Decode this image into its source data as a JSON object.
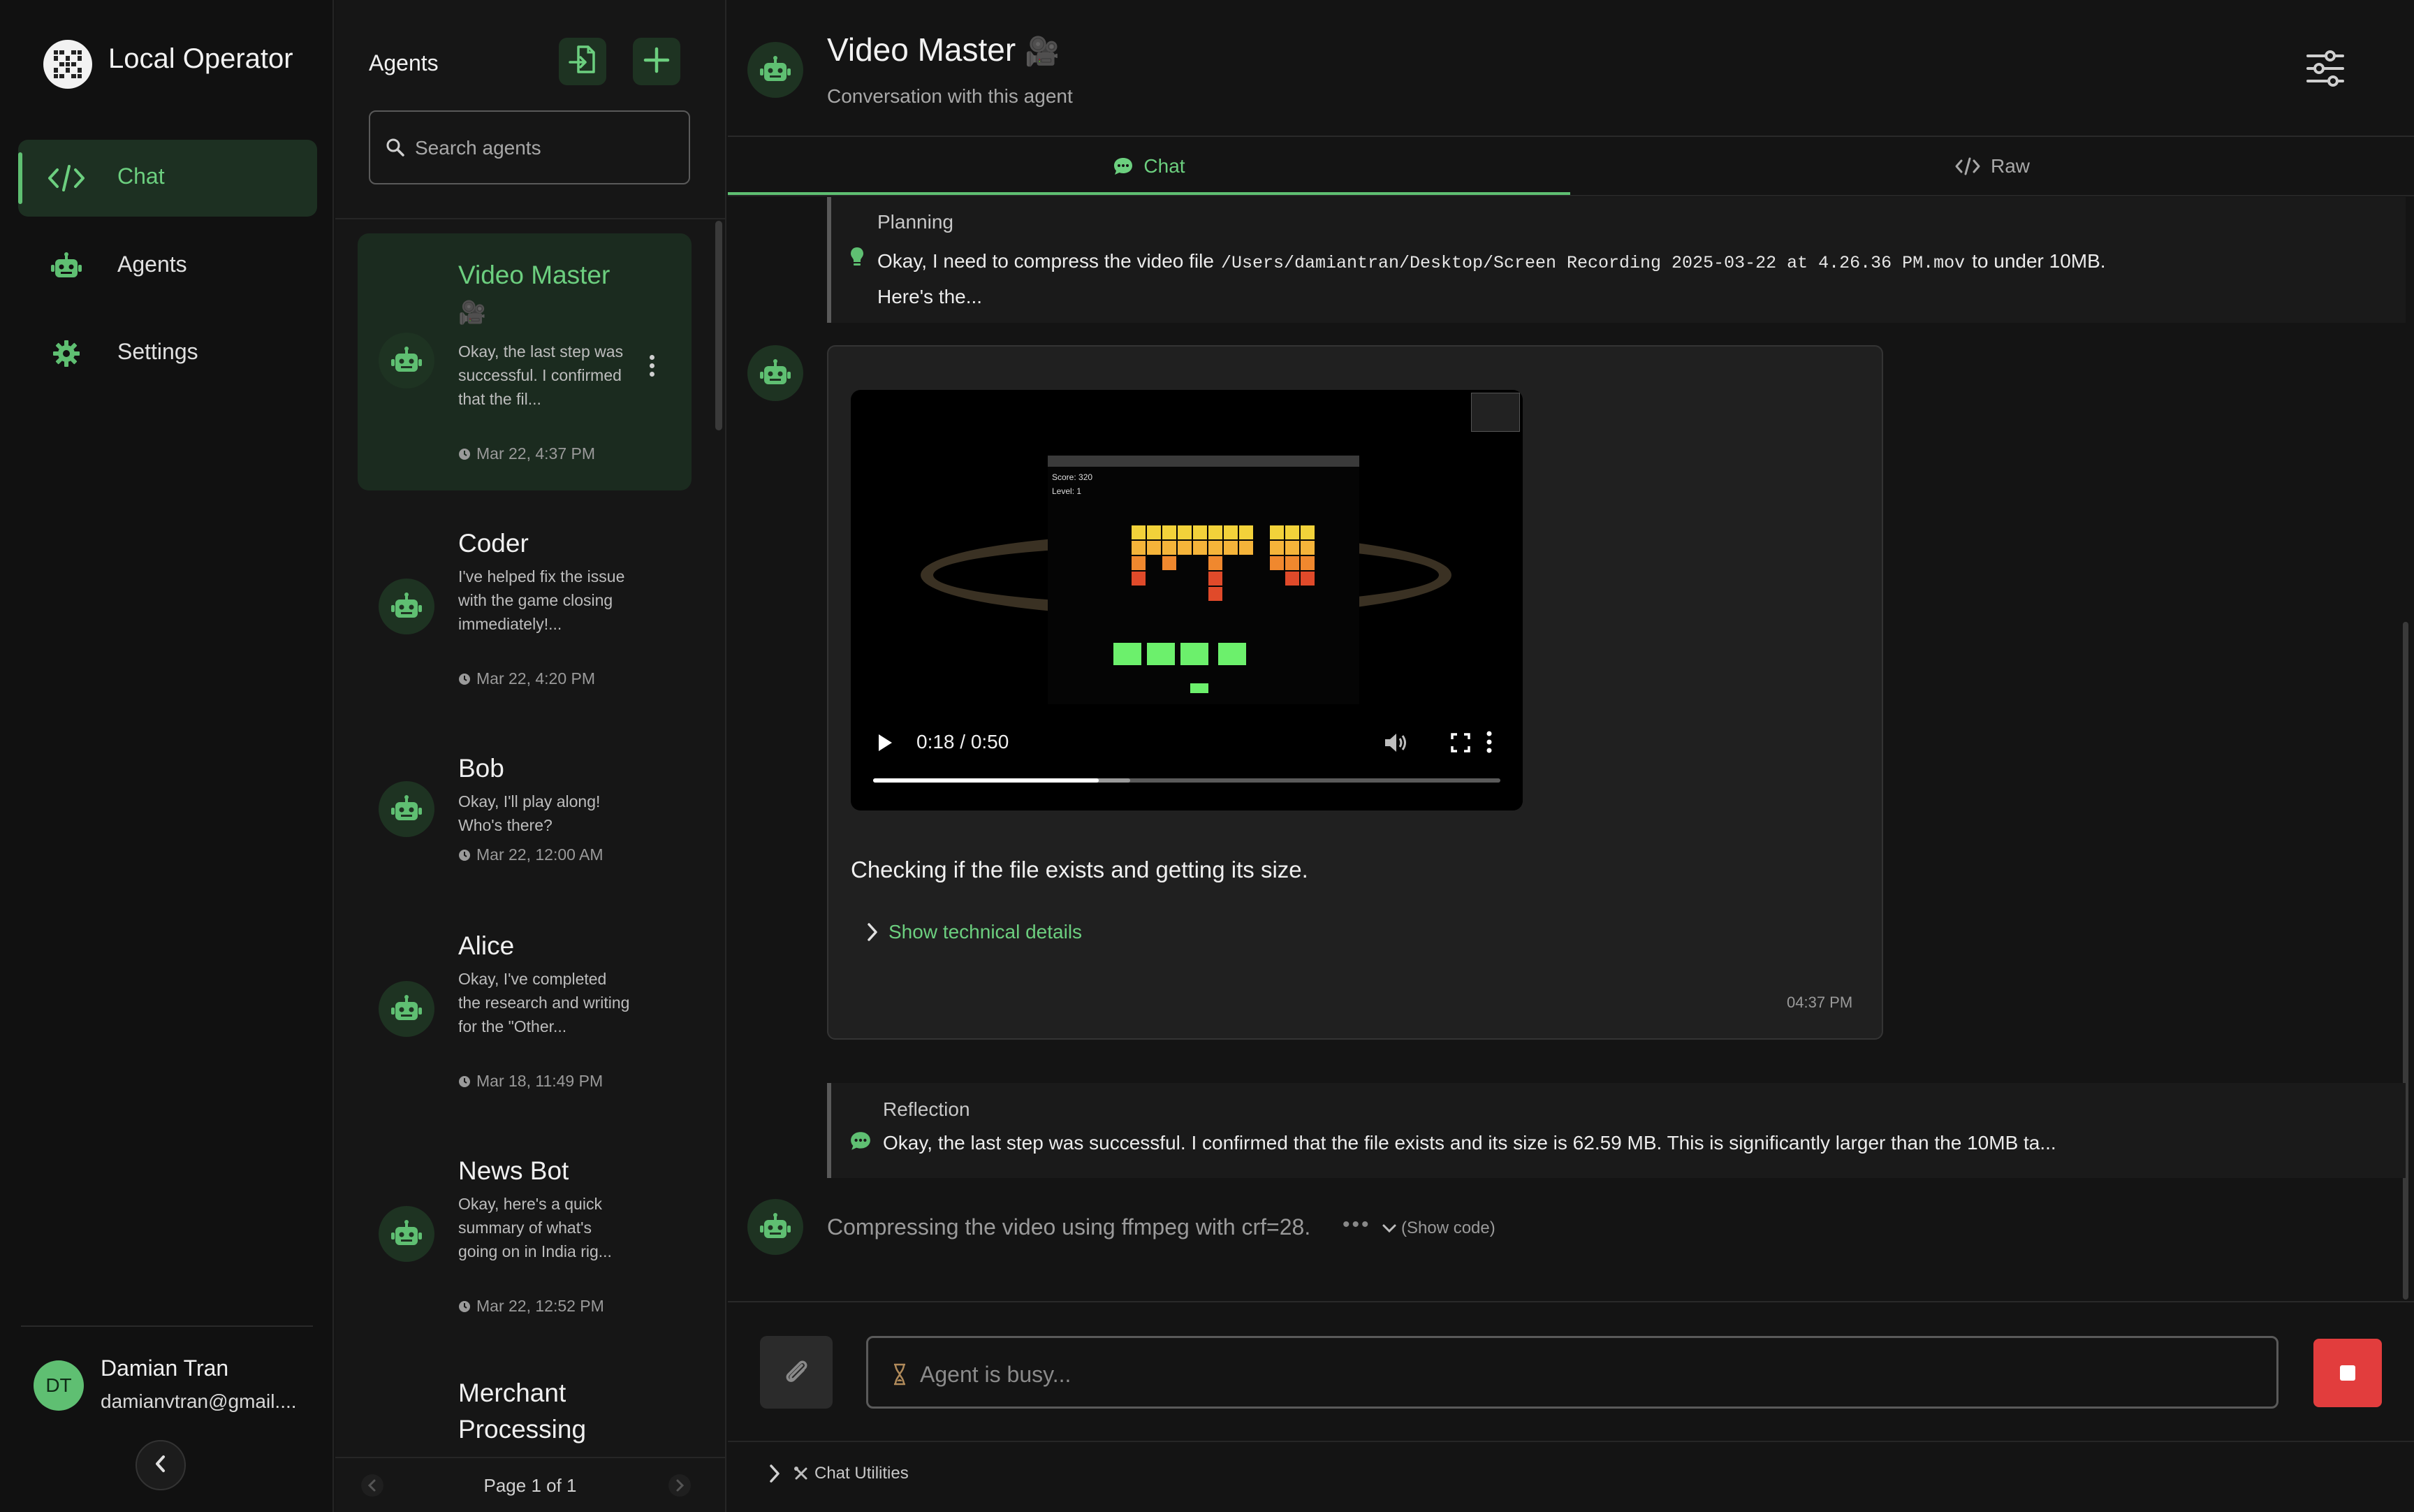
{
  "app": {
    "title": "Local Operator"
  },
  "nav": {
    "items": [
      {
        "label": "Chat",
        "icon": "code-icon",
        "active": true
      },
      {
        "label": "Agents",
        "icon": "robot-icon",
        "active": false
      },
      {
        "label": "Settings",
        "icon": "gear-icon",
        "active": false
      }
    ]
  },
  "user": {
    "initials": "DT",
    "name": "Damian Tran",
    "email": "damianvtran@gmail...."
  },
  "agents_panel": {
    "title": "Agents",
    "search_placeholder": "Search agents",
    "pagination": "Page 1 of 1",
    "list": [
      {
        "name": "Video Master",
        "emoji": "🎥",
        "preview": "Okay, the last step was successful. I confirmed that the fil...",
        "time": "Mar 22, 4:37 PM",
        "active": true
      },
      {
        "name": "Coder",
        "preview": "I've helped fix the issue with the game closing immediately!...",
        "time": "Mar 22, 4:20 PM"
      },
      {
        "name": "Bob",
        "preview": "Okay, I'll play along! Who's there?",
        "time": "Mar 22, 12:00 AM"
      },
      {
        "name": "Alice",
        "preview": "Okay, I've completed the research and writing for the \"Other...",
        "time": "Mar 18, 11:49 PM"
      },
      {
        "name": "News Bot",
        "preview": "Okay, here's a quick summary of what's going on in India rig...",
        "time": "Mar 22, 12:52 PM"
      },
      {
        "name": "Merchant Processing",
        "preview": "",
        "time": ""
      }
    ]
  },
  "chat": {
    "title": "Video Master",
    "title_emoji": "🎥",
    "subtitle": "Conversation with this agent",
    "tabs": [
      {
        "label": "Chat",
        "active": true
      },
      {
        "label": "Raw",
        "active": false
      }
    ],
    "planning": {
      "label": "Planning",
      "text_before": "Okay, I need to compress the video file",
      "path": "/Users/damiantran/Desktop/Screen Recording 2025-03-22 at 4.26.36 PM.mov",
      "text_after": "to under 10MB.",
      "text_line2": "Here's the..."
    },
    "message": {
      "video": {
        "time_display": "0:18 / 0:50",
        "progress": 0.36,
        "buffered": 0.41,
        "game": {
          "score": "Score: 320",
          "level": "Level: 1"
        }
      },
      "text": "Checking if the file exists and getting its size.",
      "tech_details": "Show technical details",
      "time": "04:37 PM"
    },
    "reflection": {
      "label": "Reflection",
      "text": "Okay, the last step was successful. I confirmed that the file exists and its size is 62.59 MB. This is significantly larger than the 10MB ta..."
    },
    "pending": {
      "text": "Compressing the video using ffmpeg with crf=28.",
      "dots": "•••",
      "show_code": "(Show code)"
    },
    "input_placeholder": "Agent is busy...",
    "utilities": "Chat Utilities"
  },
  "colors": {
    "accent": "#5fbf72",
    "stop": "#e23d3d",
    "background": "#141414"
  }
}
